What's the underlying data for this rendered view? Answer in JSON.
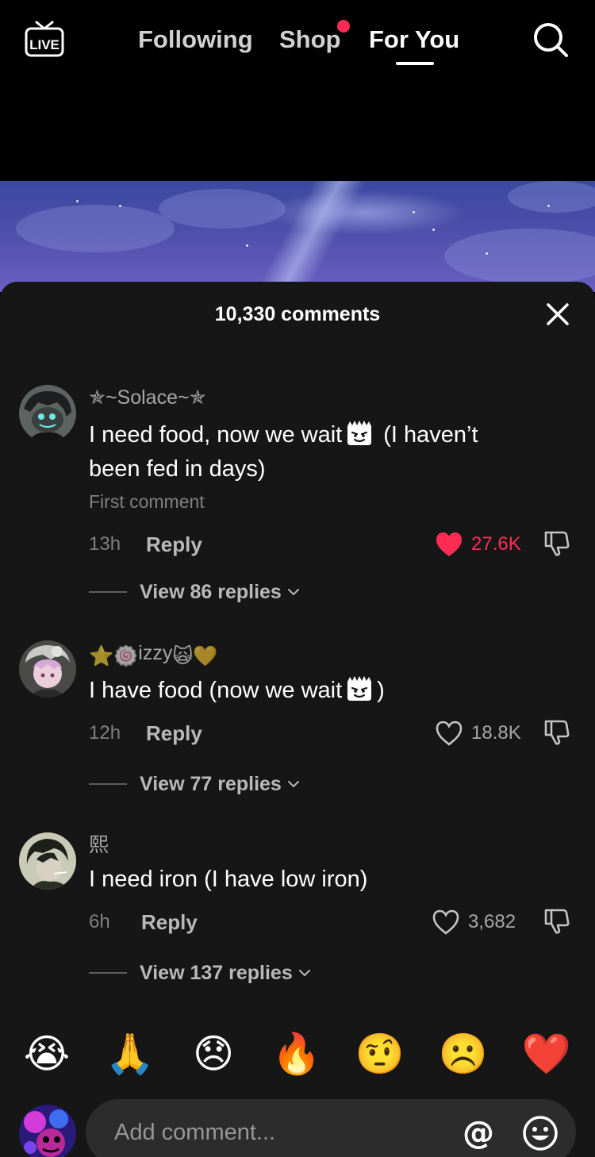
{
  "topbar": {
    "live_label": "LIVE",
    "tabs": [
      {
        "label": "Following"
      },
      {
        "label": "Shop"
      },
      {
        "label": "For You"
      }
    ],
    "active_tab": "For You",
    "shop_badge_color": "#fe2c55"
  },
  "comments_panel": {
    "title": "10,330 comments",
    "comments": [
      {
        "username": "✯~Solace~✯",
        "text_part1": "I need food, now we wait",
        "text_part2": " (I haven’t been fed in days)",
        "first_label": "First comment",
        "time": "13h",
        "reply_label": "Reply",
        "likes": "27.6K",
        "liked": true,
        "view_replies": "View 86 replies"
      },
      {
        "username_prefix": "⭐",
        "username_mid": "🍥",
        "username_text": "izzy",
        "username_suffix": "🙀💛",
        "text_part1": "I have food (now we wait",
        "text_part2": ")",
        "time": "12h",
        "reply_label": "Reply",
        "likes": "18.8K",
        "liked": false,
        "view_replies": "View 77 replies"
      },
      {
        "username": "熙",
        "text": "I need iron (I have low iron)",
        "time": "6h",
        "reply_label": "Reply",
        "likes": "3,682",
        "liked": false,
        "view_replies": "View 137 replies"
      }
    ]
  },
  "emoji_bar": [
    "😭",
    "🙏",
    "😞",
    "🔥",
    "🤨",
    "☹️",
    "❤️"
  ],
  "input": {
    "placeholder": "Add comment...",
    "at_label": "@"
  },
  "colors": {
    "accent": "#fe2c55",
    "sheet_bg": "#161616",
    "input_bg": "#2c2c2c"
  }
}
